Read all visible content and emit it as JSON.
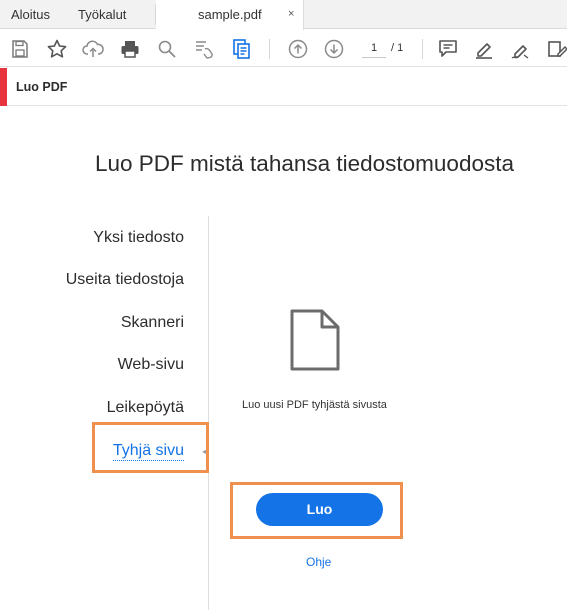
{
  "tabs": {
    "home": "Aloitus",
    "tools": "Työkalut",
    "document": "sample.pdf",
    "close": "×"
  },
  "toolbar": {
    "icons": [
      "save-icon",
      "star-icon",
      "cloud-upload-icon",
      "print-icon",
      "zoom-icon",
      "select-tool-icon",
      "create-pdf-icon",
      "page-up-icon",
      "page-down-icon",
      "comment-icon",
      "highlight-pen-icon",
      "sign-icon",
      "edit-pdf-icon"
    ],
    "page_current": "1",
    "page_total": "/ 1"
  },
  "tool_header": {
    "title": "Luo PDF",
    "accent_color": "#e8343e"
  },
  "main": {
    "title": "Luo PDF mistä tahansa tiedostomuodosta",
    "options": [
      {
        "label": "Yksi tiedosto"
      },
      {
        "label": "Useita tiedostoja"
      },
      {
        "label": "Skanneri"
      },
      {
        "label": "Web-sivu"
      },
      {
        "label": "Leikepöytä"
      },
      {
        "label": "Tyhjä sivu",
        "selected": true
      }
    ],
    "description": "Luo uusi PDF tyhjästä sivusta",
    "create_button": "Luo",
    "help_link": "Ohje"
  },
  "colors": {
    "accent": "#1473e6",
    "highlight": "#f0904f"
  }
}
